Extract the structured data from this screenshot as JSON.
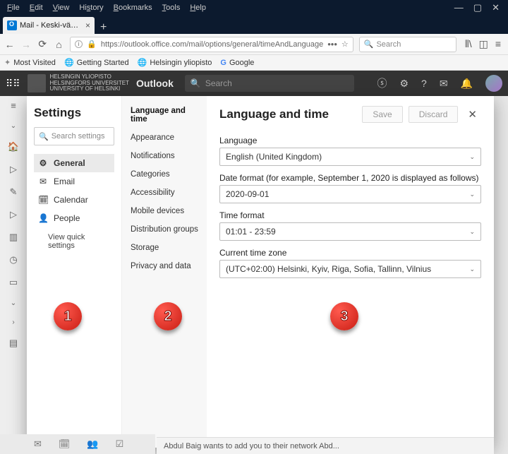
{
  "menubar": {
    "file": "File",
    "edit": "Edit",
    "view": "View",
    "history": "History",
    "bookmarks": "Bookmarks",
    "tools": "Tools",
    "help": "Help"
  },
  "tab": {
    "title": "Mail - Keski-vääntö, Raimo - O"
  },
  "url": "https://outlook.office.com/mail/options/general/timeAndLanguage",
  "search_placeholder": "Search",
  "bookmarks": {
    "most_visited": "Most Visited",
    "getting_started": "Getting Started",
    "helsinki": "Helsingin yliopisto",
    "google": "Google"
  },
  "suite": {
    "app": "Outlook",
    "search": "Search",
    "uni_line1": "HELSINGIN YLIOPISTO",
    "uni_line2": "HELSINGFORS UNIVERSITET",
    "uni_line3": "UNIVERSITY OF HELSINKI"
  },
  "settings": {
    "title": "Settings",
    "search_placeholder": "Search settings",
    "nav": {
      "general": "General",
      "email": "Email",
      "calendar": "Calendar",
      "people": "People",
      "quick": "View quick settings"
    }
  },
  "col2": {
    "items": [
      "Language and time",
      "Appearance",
      "Notifications",
      "Categories",
      "Accessibility",
      "Mobile devices",
      "Distribution groups",
      "Storage",
      "Privacy and data"
    ]
  },
  "panel": {
    "title": "Language and time",
    "save": "Save",
    "discard": "Discard",
    "language_label": "Language",
    "language_value": "English (United Kingdom)",
    "date_label": "Date format (for example, September 1, 2020 is displayed as follows)",
    "date_value": "2020-09-01",
    "time_label": "Time format",
    "time_value": "01:01 - 23:59",
    "tz_label": "Current time zone",
    "tz_value": "(UTC+02:00) Helsinki, Kyiv, Riga, Sofia, Tallinn, Vilnius"
  },
  "bottom_msg": "Abdul Baig wants to add you to their network Abd...",
  "badges": {
    "b1": "1",
    "b2": "2",
    "b3": "3"
  }
}
